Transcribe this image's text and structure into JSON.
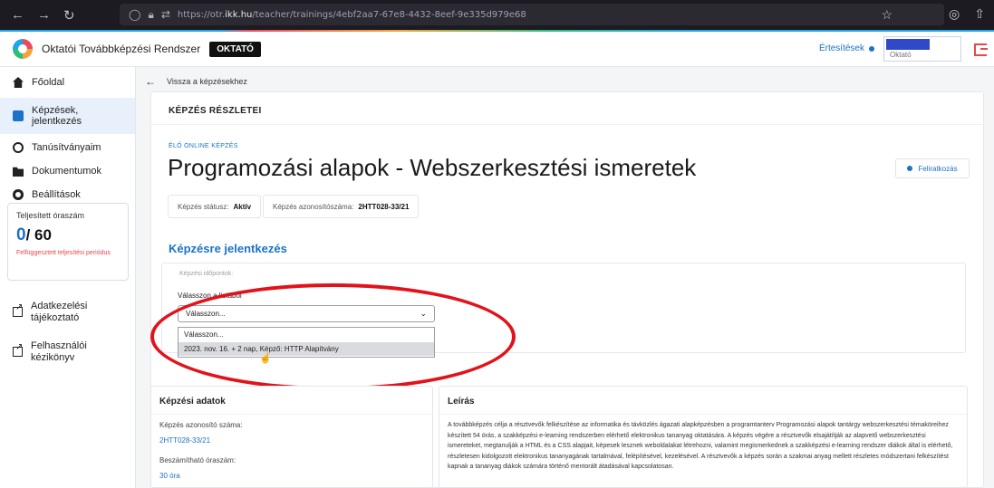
{
  "browser": {
    "url_prefix": "https://otr.",
    "url_domain": "ikk.hu",
    "url_path": "/teacher/trainings/4ebf2aa7-67e8-4432-8eef-9e335d979e68"
  },
  "header": {
    "app_title": "Oktatói Továbbképzési Rendszer",
    "role_badge": "OKTATÓ",
    "notifications_label": "Értesítések",
    "user_role": "Oktató"
  },
  "sidebar": {
    "items": [
      {
        "label": "Főoldal",
        "icon": "home-icon"
      },
      {
        "label": "Képzések, jelentkezés",
        "icon": "courses-icon"
      },
      {
        "label": "Tanúsítványaim",
        "icon": "certificate-icon"
      },
      {
        "label": "Dokumentumok",
        "icon": "folder-icon"
      },
      {
        "label": "Beállítások",
        "icon": "gear-icon"
      }
    ],
    "hours": {
      "label": "Teljesített óraszám",
      "current": "0",
      "total": "/ 60",
      "warning": "Felfüggesztett teljesítési periódus"
    },
    "links": [
      {
        "label": "Adatkezelési tájékoztató",
        "icon": "external-link-icon"
      },
      {
        "label": "Felhasználói kézikönyv",
        "icon": "external-link-icon"
      }
    ]
  },
  "main": {
    "back_label": "Vissza a képzésekhez",
    "section_title": "KÉPZÉS RÉSZLETEI",
    "course_type": "ÉLŐ ONLINE KÉPZÉS",
    "course_title": "Programozási alapok - Webszerkesztési ismeretek",
    "signup_button": "Feliratkozás",
    "status_label": "Képzés státusz:",
    "status_value": "Aktív",
    "id_label": "Képzés azonosítószáma:",
    "id_value": "2HTT028-33/21",
    "registration_title": "Képzésre jelentkezés",
    "registration_subtitle": "Képzési időpontok:",
    "select_label": "Válasszon a listából",
    "select_value": "Válasszon...",
    "options": [
      "Válasszon...",
      "2023. nov. 16. + 2 nap, Képző: HTTP Alapítvány"
    ]
  },
  "info": {
    "title": "Képzési adatok",
    "id_label": "Képzés azonosító száma:",
    "id_value": "2HTT028-33/21",
    "hours_label": "Beszámítható óraszám:",
    "hours_value": "30 óra"
  },
  "description": {
    "title": "Leírás",
    "text": "A továbbképzés célja a résztvevők felkészítése az informatika és távközlés ágazati alapképzésben a programtanterv Programozási alapok tantárgy webszerkesztési témaköreihez készített 54 órás, a szakképzési e-learning rendszerben elérhető elektronikus tananyag oktatására. A képzés végére a résztvevők elsajátítják az alapvető webszerkesztési ismereteket, megtanulják a HTML és a CSS alapjait, képesek lesznek weboldalakat létrehozni, valamint megismerkednek a szakképzési e-learning rendszer diákok által is elérhető, részletesen kidolgozott elektronikus tananyagának tartalmával, felépítésével, kezelésével. A résztvevők a képzés során a szakmai anyag mellett részletes módszertani felkészítést kapnak a tananyag diákok számára történő mentorált átadásával kapcsolatosan."
  },
  "colors": {
    "accent": "#1a73c9",
    "annotation": "#e3121a",
    "warning": "#e5484d"
  }
}
